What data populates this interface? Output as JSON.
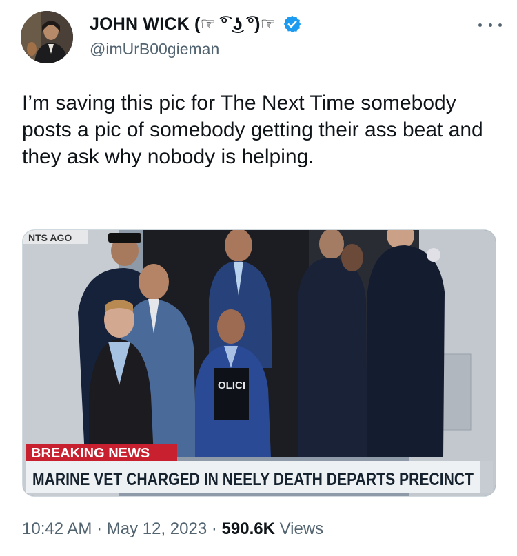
{
  "author": {
    "display_name": "JOHN WICK (☞ ͡° ͜ʖ ͡°)☞",
    "handle": "@imUrB00gieman",
    "avatar_icon": "avatar-man-in-suit",
    "verified_icon": "verified-badge-icon",
    "verified_color": "#1d9bf0"
  },
  "more_icon": "more-options-icon",
  "tweet": {
    "text": "I’m saving this pic for The Next Time somebody posts a pic of somebody getting their ass beat and they ask why nobody is helping."
  },
  "media": {
    "chyron_time": "NTS AGO",
    "breaking_label": "BREAKING NEWS",
    "headline": "MARINE VET CHARGED IN NEELY DEATH DEPARTS PRECINCT",
    "vest_text": "OLICI",
    "breaking_color": "#c8202e"
  },
  "meta": {
    "time": "10:42 AM",
    "separator": "·",
    "date": "May 12, 2023",
    "views_count": "590.6K",
    "views_label": "Views"
  }
}
